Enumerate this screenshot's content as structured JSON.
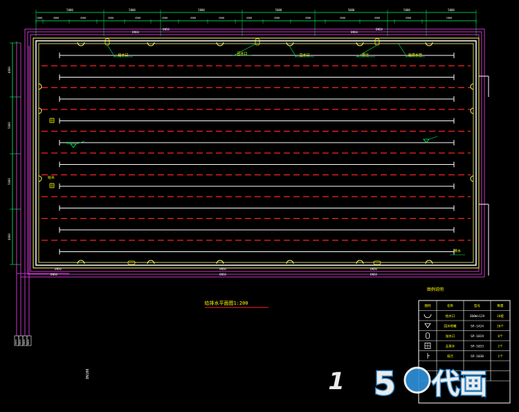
{
  "drawing": {
    "title": "给排水平面图1:200",
    "colors": {
      "background": "#000000",
      "wall": "#ffffff",
      "wall_inner": "#ffff66",
      "pipe_magenta": "#cc33cc",
      "lane_rope": "#ff2222",
      "dimension": "#00ff66",
      "label": "#ffff00",
      "title_underline": "#ff2222"
    },
    "top_dimensions": [
      "5000",
      "5000",
      "5000",
      "5000",
      "5000",
      "5000",
      "5000"
    ],
    "top_sub_dimensions": [
      "1000",
      "4000",
      "4500",
      "4500",
      "4500",
      "4500",
      "4500",
      "4500",
      "4500",
      "4500",
      "4500",
      "4500",
      "4500",
      "4500",
      "1000"
    ],
    "left_dimensions": [
      "4000",
      "5000",
      "5000",
      "4000"
    ],
    "pipe_tags_top": [
      "DN50",
      "DN50",
      "DN50",
      "DN50"
    ],
    "pipe_tags_bottom": [
      "DN50",
      "DN50",
      "DN50"
    ],
    "callouts": [
      "给水口",
      "回水口",
      "溢水口",
      "排污",
      "给排水管"
    ],
    "side_labels": [
      "给水",
      "给水"
    ],
    "right_label": "排水",
    "riser_labels": [
      "DN50",
      "DN50",
      "DN50",
      "DN50"
    ],
    "vertical_note": "DN100"
  },
  "legend": {
    "title": "图例说明",
    "headers": [
      "图例",
      "名称",
      "型号",
      "数量"
    ],
    "rows": [
      {
        "icon": "half-circle-icon",
        "name": "给水口",
        "model": "300W×12V",
        "qty": "18套"
      },
      {
        "icon": "triangle-down-icon",
        "name": "回水喷嘴",
        "model": "SP-1424",
        "qty": "20个"
      },
      {
        "icon": "capsule-icon",
        "name": "溢水口",
        "model": "SP-1019",
        "qty": "8个"
      },
      {
        "icon": "grid-drain-icon",
        "name": "主排水",
        "model": "SP-1033",
        "qty": "2个"
      },
      {
        "icon": "valve-icon",
        "name": "排污",
        "model": "SP-1030",
        "qty": "1个"
      },
      {
        "icon": "blank-icon",
        "name": "",
        "model": "",
        "qty": ""
      },
      {
        "icon": "blank-icon",
        "name": "",
        "model": "",
        "qty": ""
      }
    ]
  },
  "watermark": {
    "number": "5",
    "glyph": "1",
    "text": "代画"
  }
}
